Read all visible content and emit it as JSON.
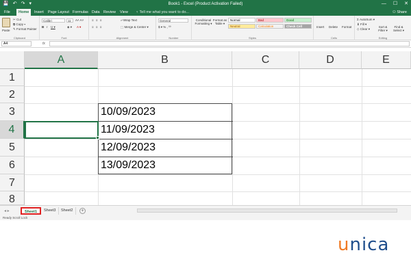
{
  "titlebar": {
    "title": "Book1 - Excel (Product Activation Failed)",
    "qat": [
      "💾",
      "↶",
      "↷",
      "▾"
    ],
    "window_buttons": [
      "—",
      "☐",
      "✕"
    ]
  },
  "menu": {
    "tabs": [
      "File",
      "Home",
      "Insert",
      "Page Layout",
      "Formulas",
      "Data",
      "Review",
      "View"
    ],
    "tell_me": "♀ Tell me what you want to do...",
    "share": "⚇ Share"
  },
  "ribbon": {
    "clipboard": {
      "label": "Clipboard",
      "paste": "Paste",
      "cut": "✂ Cut",
      "copy": "⧉ Copy ▾",
      "format_painter": "✎ Format Painter"
    },
    "font": {
      "label": "Font",
      "font_name": "Calibri",
      "font_size": "11",
      "grow": "A˄ A˅",
      "bold": "B",
      "italic": "I",
      "underline": "U ▾",
      "fill": "◈ ▾",
      "color": "A ▾"
    },
    "alignment": {
      "label": "Alignment",
      "wrap_text": "⤶ Wrap Text",
      "merge_center": "⬚ Merge & Center ▾"
    },
    "number": {
      "label": "Number",
      "format": "General",
      "symbols": "$ ▾  %  ,  ⁰⁰"
    },
    "styles": {
      "label": "Styles",
      "conditional": "Conditional Formatting ▾",
      "format_as_table": "Format as Table ▾",
      "cells": [
        {
          "name": "Normal",
          "bg": "#ffffff",
          "fg": "#000000"
        },
        {
          "name": "Bad",
          "bg": "#ffc7ce",
          "fg": "#9c0006"
        },
        {
          "name": "Good",
          "bg": "#c6efce",
          "fg": "#006100"
        },
        {
          "name": "Neutral",
          "bg": "#ffeb9c",
          "fg": "#9c5700"
        },
        {
          "name": "Calculation",
          "bg": "#f2f2f2",
          "fg": "#fa7d00"
        },
        {
          "name": "Check Cell",
          "bg": "#a5a5a5",
          "fg": "#ffffff"
        }
      ]
    },
    "cells": {
      "label": "Cells",
      "insert": "Insert",
      "delete": "Delete",
      "format": "Format"
    },
    "editing": {
      "label": "Editing",
      "autosum": "Σ AutoSum ▾",
      "fill": "⬇ Fill ▾",
      "clear": "◇ Clear ▾",
      "sort": "Sort & Filter ▾",
      "find": "Find & Select ▾"
    }
  },
  "formula_bar": {
    "name_box": "A4",
    "fx": "fx",
    "content": ""
  },
  "grid": {
    "columns": [
      "A",
      "B",
      "C",
      "D",
      "E"
    ],
    "rows": [
      "1",
      "2",
      "3",
      "4",
      "5",
      "6",
      "7",
      "8"
    ],
    "selected_cell": "A4",
    "cells": [
      "10/09/2023",
      "11/09/2023",
      "12/09/2023",
      "13/09/2023"
    ]
  },
  "sheets": {
    "nav": "◂ ▸",
    "tabs": [
      "Sheet1",
      "Sheet3",
      "Sheet2"
    ],
    "active": "Sheet1",
    "add": "+"
  },
  "statusbar": {
    "text": "Ready     Scroll Lock"
  },
  "watermark": {
    "first": "u",
    "rest": "nica"
  },
  "accent": "#217346",
  "highlight": "#e02020"
}
